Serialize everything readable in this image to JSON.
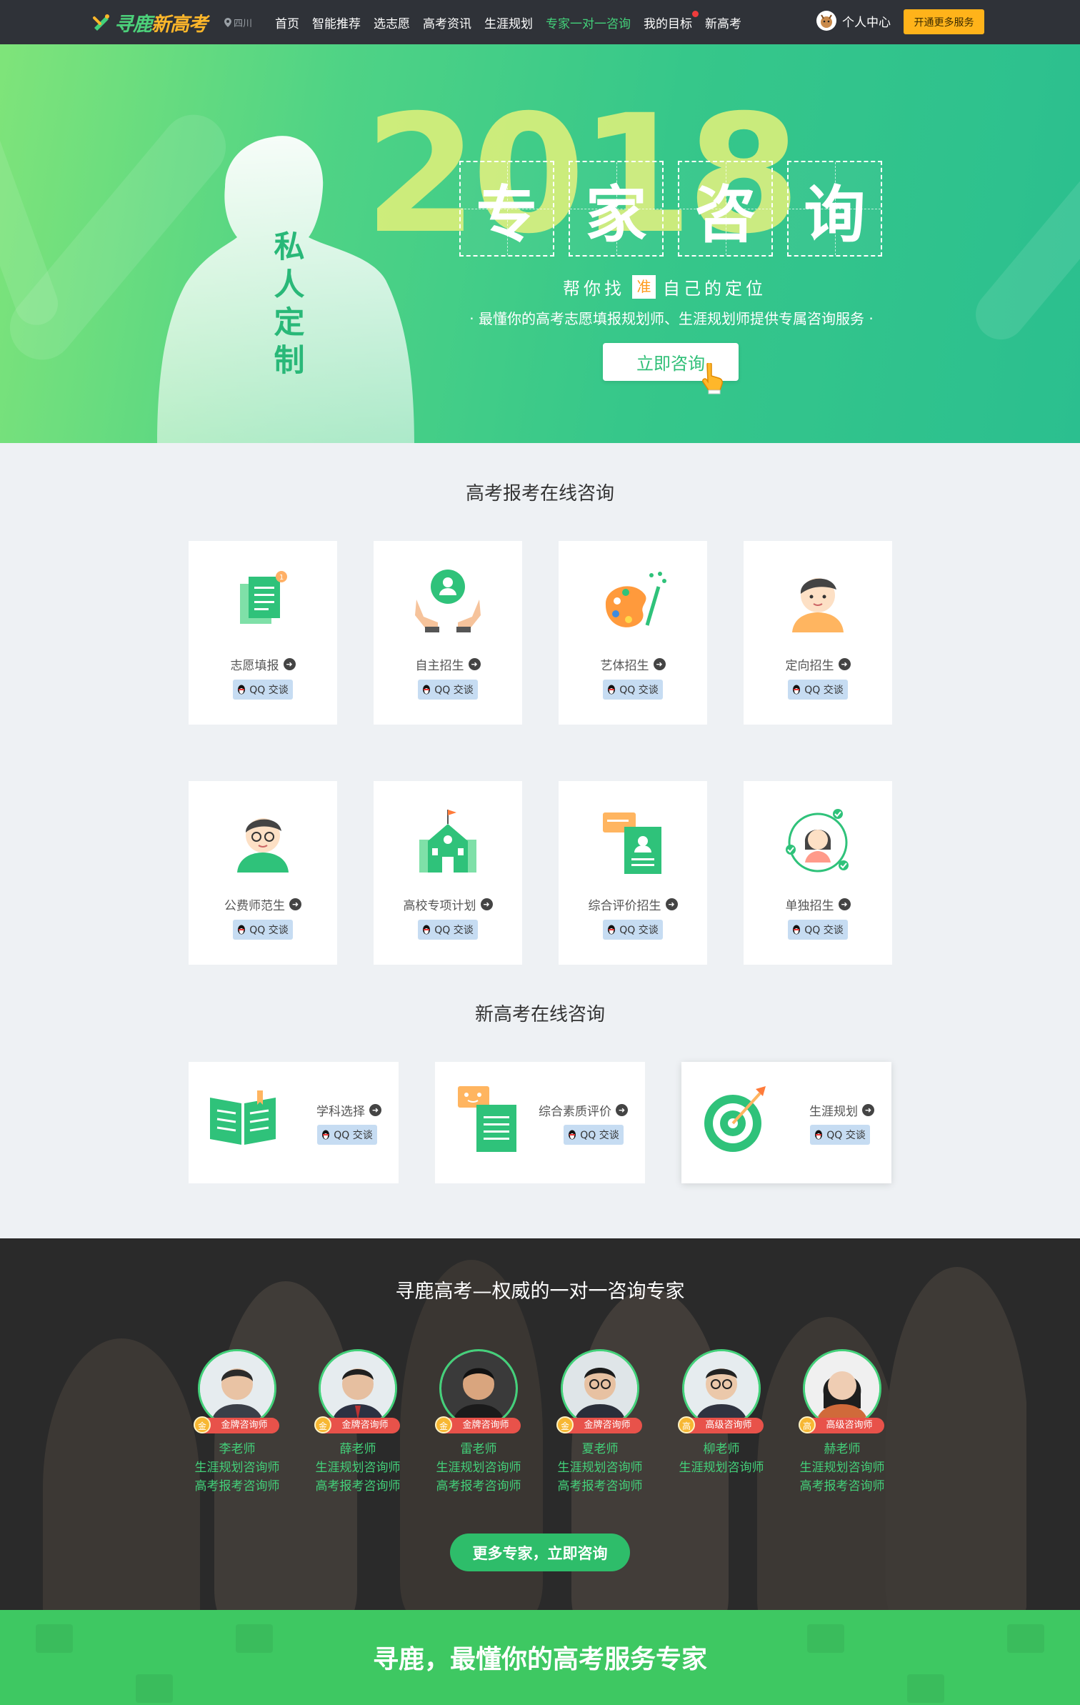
{
  "nav": {
    "logo_main": "寻鹿",
    "logo_accent": "新高考",
    "location": "四川",
    "items": [
      {
        "label": "首页",
        "active": false
      },
      {
        "label": "智能推荐",
        "active": false
      },
      {
        "label": "选志愿",
        "active": false
      },
      {
        "label": "高考资讯",
        "active": false
      },
      {
        "label": "生涯规划",
        "active": false
      },
      {
        "label": "专家一对一咨询",
        "active": true
      },
      {
        "label": "我的目标",
        "active": false
      },
      {
        "label": "新高考",
        "active": false
      }
    ],
    "user_label": "个人中心",
    "vip_button": "开通更多服务"
  },
  "hero": {
    "year": "2018",
    "vertical_title": [
      "私",
      "人",
      "定",
      "制"
    ],
    "title_chars": [
      "专",
      "家",
      "咨",
      "询"
    ],
    "subtitle_before": "帮你找",
    "subtitle_mark": "准",
    "subtitle_after": "自己的定位",
    "description": "· 最懂你的高考志愿填报规划师、生涯规划师提供专属咨询服务 ·",
    "button": "立即咨询"
  },
  "section1": {
    "title": "高考报考在线咨询",
    "cards": [
      {
        "label": "志愿填报",
        "icon": "documents-icon",
        "qq": "QQ 交谈"
      },
      {
        "label": "自主招生",
        "icon": "hands-person-icon",
        "qq": "QQ 交谈"
      },
      {
        "label": "艺体招生",
        "icon": "palette-icon",
        "qq": "QQ 交谈"
      },
      {
        "label": "定向招生",
        "icon": "boy-avatar-icon",
        "qq": "QQ 交谈"
      },
      {
        "label": "公费师范生",
        "icon": "teacher-glasses-icon",
        "qq": "QQ 交谈"
      },
      {
        "label": "高校专项计划",
        "icon": "school-building-icon",
        "qq": "QQ 交谈"
      },
      {
        "label": "综合评价招生",
        "icon": "profile-card-icon",
        "qq": "QQ 交谈"
      },
      {
        "label": "单独招生",
        "icon": "girl-check-icon",
        "qq": "QQ 交谈"
      }
    ]
  },
  "section2": {
    "title": "新高考在线咨询",
    "cards": [
      {
        "label": "学科选择",
        "icon": "open-book-icon",
        "qq": "QQ 交谈"
      },
      {
        "label": "综合素质评价",
        "icon": "document-chat-icon",
        "qq": "QQ 交谈"
      },
      {
        "label": "生涯规划",
        "icon": "target-icon",
        "qq": "QQ 交谈"
      }
    ]
  },
  "experts": {
    "title": "寻鹿高考—权威的一对一咨询专家",
    "list": [
      {
        "name": "李老师",
        "badge": "金牌咨询师",
        "medal": "金",
        "roles": [
          "生涯规划咨询师",
          "高考报考咨询师"
        ]
      },
      {
        "name": "薛老师",
        "badge": "金牌咨询师",
        "medal": "金",
        "roles": [
          "生涯规划咨询师",
          "高考报考咨询师"
        ]
      },
      {
        "name": "雷老师",
        "badge": "金牌咨询师",
        "medal": "金",
        "roles": [
          "生涯规划咨询师",
          "高考报考咨询师"
        ]
      },
      {
        "name": "夏老师",
        "badge": "金牌咨询师",
        "medal": "金",
        "roles": [
          "生涯规划咨询师",
          "高考报考咨询师"
        ]
      },
      {
        "name": "柳老师",
        "badge": "高级咨询师",
        "medal": "高",
        "roles": [
          "生涯规划咨询师"
        ]
      },
      {
        "name": "赫老师",
        "badge": "高级咨询师",
        "medal": "高",
        "roles": [
          "生涯规划咨询师",
          "高考报考咨询师"
        ]
      }
    ],
    "more_button": "更多专家，立即咨询"
  },
  "footer": {
    "slogan": "寻鹿，最懂你的高考服务专家"
  },
  "colors": {
    "nav_bg": "#2f3238",
    "brand_green": "#43d17a",
    "vip_orange": "#ffb31a",
    "footer_green": "#3ec862"
  }
}
